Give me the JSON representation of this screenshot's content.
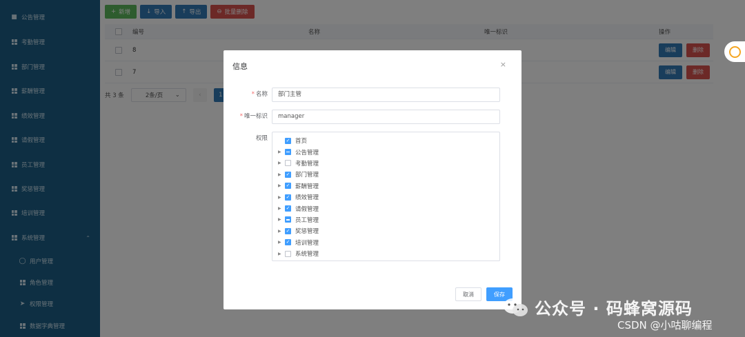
{
  "sidebar": {
    "items": [
      {
        "label": "公告管理",
        "icon": "notice-icon"
      },
      {
        "label": "考勤管理",
        "icon": "grid-icon"
      },
      {
        "label": "部门管理",
        "icon": "grid-icon"
      },
      {
        "label": "薪酬管理",
        "icon": "grid-icon"
      },
      {
        "label": "绩效管理",
        "icon": "grid-icon"
      },
      {
        "label": "请假管理",
        "icon": "grid-icon"
      },
      {
        "label": "员工管理",
        "icon": "grid-icon"
      },
      {
        "label": "奖惩管理",
        "icon": "grid-icon"
      },
      {
        "label": "培训管理",
        "icon": "grid-icon"
      },
      {
        "label": "系统管理",
        "icon": "apps-icon",
        "expanded": true
      }
    ],
    "sub_items": [
      {
        "label": "用户管理",
        "icon": "user-icon"
      },
      {
        "label": "角色管理",
        "icon": "grid-icon"
      },
      {
        "label": "权限管理",
        "icon": "send-icon"
      },
      {
        "label": "数据字典管理",
        "icon": "grid-icon"
      }
    ]
  },
  "toolbar": {
    "add_label": "新增",
    "import_label": "导入",
    "export_label": "导出",
    "batch_delete_label": "批量删除"
  },
  "table": {
    "headers": {
      "id": "编号",
      "name": "名称",
      "key": "唯一标识",
      "op": "操作"
    },
    "rows": [
      {
        "id": "8"
      },
      {
        "id": "7"
      }
    ],
    "edit_label": "编辑",
    "delete_label": "删除"
  },
  "pager": {
    "total": "共 3 条",
    "page_size": "2条/页",
    "current_page": "1"
  },
  "dialog": {
    "title": "信息",
    "close": "×",
    "name_label": "名称",
    "name_value": "部门主管",
    "key_label": "唯一标识",
    "key_value": "manager",
    "perm_label": "权限",
    "tree": [
      {
        "label": "首页",
        "state": "on",
        "has_children": false
      },
      {
        "label": "公告管理",
        "state": "part",
        "has_children": true
      },
      {
        "label": "考勤管理",
        "state": "off",
        "has_children": true
      },
      {
        "label": "部门管理",
        "state": "on",
        "has_children": true
      },
      {
        "label": "薪酬管理",
        "state": "on",
        "has_children": true
      },
      {
        "label": "绩效管理",
        "state": "on",
        "has_children": true
      },
      {
        "label": "请假管理",
        "state": "on",
        "has_children": true
      },
      {
        "label": "员工管理",
        "state": "part",
        "has_children": true
      },
      {
        "label": "奖惩管理",
        "state": "on",
        "has_children": true
      },
      {
        "label": "培训管理",
        "state": "on",
        "has_children": true
      },
      {
        "label": "系统管理",
        "state": "off",
        "has_children": true
      }
    ],
    "cancel_label": "取消",
    "save_label": "保存"
  },
  "watermark": {
    "line1": "公众号 · 码蜂窝源码",
    "line2": "CSDN @小咕聊编程"
  },
  "colors": {
    "sidebar": "#1c5f86",
    "primary": "#409eff",
    "table_btn_blue": "#337ab7",
    "danger": "#d9534f",
    "success": "#5cb85c",
    "widget_ring": "#f5a623"
  }
}
